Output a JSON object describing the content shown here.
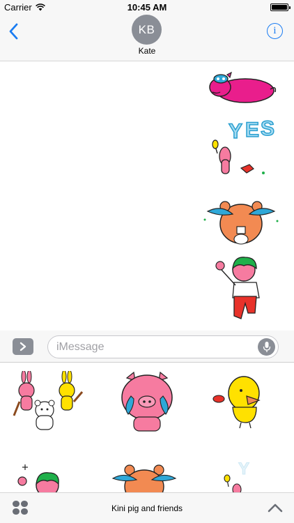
{
  "status_bar": {
    "carrier": "Carrier",
    "time": "10:45 AM"
  },
  "header": {
    "back_icon": "chevron-left-icon",
    "avatar_initials": "KB",
    "contact_name": "Kate",
    "info_icon": "info-icon",
    "info_glyph": "i"
  },
  "conversation": {
    "stickers": [
      {
        "name": "sticker-pink-pig-lying",
        "icon": "pink-pig-sticker"
      },
      {
        "name": "sticker-yes-pink-character",
        "icon": "yes-sticker"
      },
      {
        "name": "sticker-crying-hamster",
        "icon": "crying-hamster-sticker"
      },
      {
        "name": "sticker-green-hair-boy-waving",
        "icon": "green-hair-boy-sticker"
      }
    ]
  },
  "compose": {
    "placeholder": "iMessage",
    "apps_icon": "chevron-right-icon",
    "mic_icon": "microphone-icon"
  },
  "drawer": {
    "stickers": [
      {
        "name": "bunnies-bear-sticker"
      },
      {
        "name": "crying-pig-sticker"
      },
      {
        "name": "yellow-chick-sticker"
      },
      {
        "name": "green-hair-boy-sticker"
      },
      {
        "name": "crying-hamster-sticker"
      },
      {
        "name": "yes-sticker"
      }
    ]
  },
  "app_bar": {
    "app_name": "Kini pig and friends",
    "grid_icon": "app-drawer-icon",
    "expand_icon": "chevron-up-icon"
  },
  "colors": {
    "accent": "#1a7cf2",
    "gray": "#8a8e96",
    "pink": "#f67ba0",
    "magenta": "#e91e8c",
    "orange": "#f28a52",
    "teal": "#2fa8d8",
    "yellow": "#ffe100",
    "green": "#1fb04a",
    "red": "#e8322a"
  }
}
